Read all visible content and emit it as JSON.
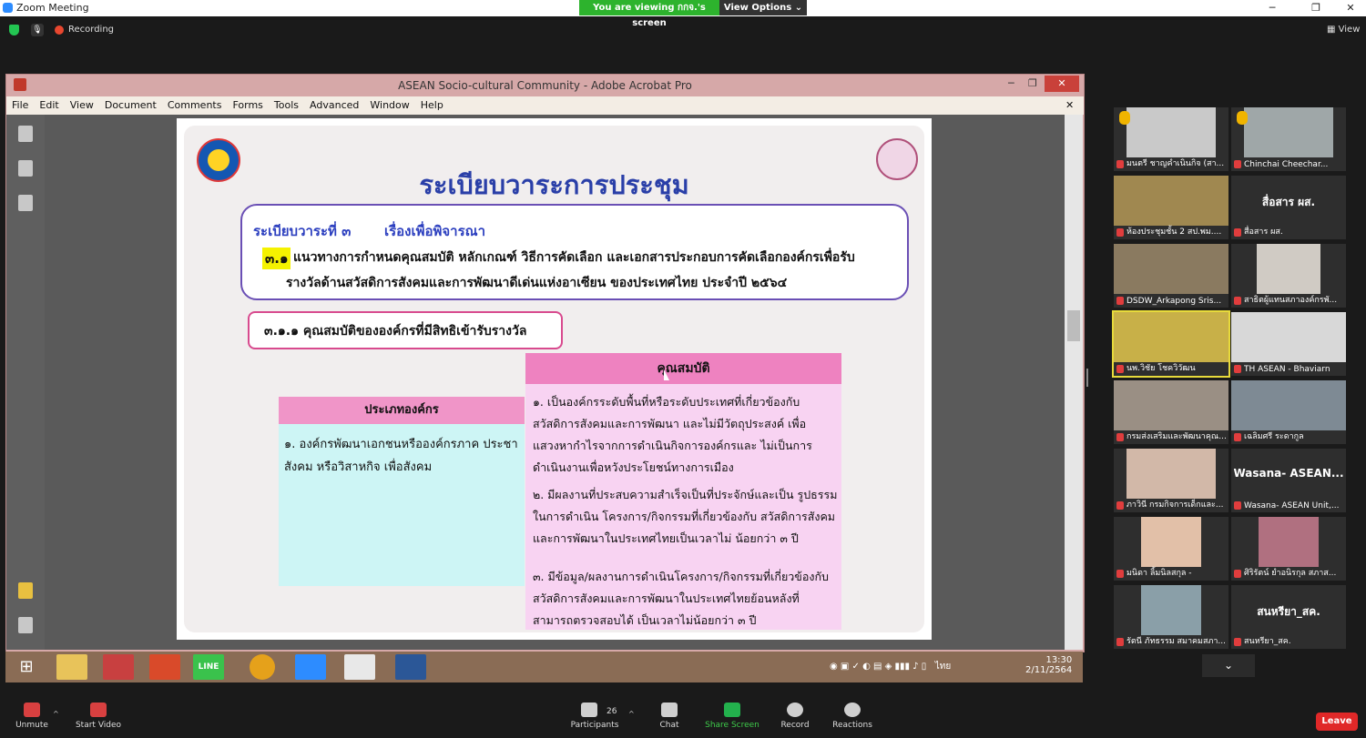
{
  "window": {
    "title": "Zoom Meeting",
    "viewing_banner": "You are viewing กกจ.'s screen",
    "view_options": "View Options ⌄",
    "min": "─",
    "max": "❐",
    "close": "✕"
  },
  "status": {
    "recording": "Recording",
    "view": "View"
  },
  "acrobat": {
    "title": "ASEAN Socio-cultural Community - Adobe Acrobat Pro",
    "menu": [
      "File",
      "Edit",
      "View",
      "Document",
      "Comments",
      "Forms",
      "Tools",
      "Advanced",
      "Window",
      "Help"
    ],
    "close_doc": "✕"
  },
  "slide": {
    "title": "ระเบียบวาระการประชุม",
    "agenda_heading": "ระเบียบวาระที่ ๓       เรื่องเพื่อพิจารณา",
    "item_num": "๓.๑",
    "item_line1": "แนวทางการกำหนดคุณสมบัติ หลักเกณฑ์ วิธีการคัดเลือก และเอกสารประกอบการคัดเลือกองค์กรเพื่อรับ",
    "item_line2": "รางวัลด้านสวัสดิการสังคมและการพัฒนาดีเด่นแห่งอาเซียน ของประเทศไทย ประจำปี ๒๕๖๔",
    "sub_item": "๓.๑.๑ คุณสมบัติขององค์กรที่มีสิทธิเข้ารับรางวัล",
    "left_header": "ประเภทองค์กร",
    "left_text": "๑.   องค์กรพัฒนาเอกชนหรือองค์กรภาค ประชาสังคม หรือวิสาหกิจ เพื่อสังคม",
    "right_header": "คุณสมบัติ",
    "right_items": [
      "๑.   เป็นองค์กรระดับพื้นที่หรือระดับประเทศที่เกี่ยวข้องกับ สวัสดิการสังคมและการพัฒนา และไม่มีวัตถุประสงค์ เพื่อแสวงหากำไรจากการดำเนินกิจการองค์กรและ ไม่เป็นการดำเนินงานเพื่อหวังประโยชน์ทางการเมือง",
      "๒.   มีผลงานที่ประสบความสำเร็จเป็นที่ประจักษ์และเป็น รูปธรรมในการดำเนิน โครงการ/กิจกรรมที่เกี่ยวข้องกับ สวัสดิการสังคมและการพัฒนาในประเทศไทยเป็นเวลาไม่ น้อยกว่า ๓ ปี",
      "๓.   มีข้อมูล/ผลงานการดำเนินโครงการ/กิจกรรมที่เกี่ยวข้องกับ สวัสดิการสังคมและการพัฒนาในประเทศไทยย้อนหลังที่ สามารถตรวจสอบได้ เป็นเวลาไม่น้อยกว่า ๓ ปี"
    ]
  },
  "taskbar": {
    "tray": "ไทย",
    "time": "13:30",
    "date": "2/11/2564"
  },
  "participants": [
    {
      "name": "มนตรี ชาญคำเนินกิจ (สา...",
      "big": ""
    },
    {
      "name": "Chinchai Cheechar...",
      "big": ""
    },
    {
      "name": "ห้องประชุมชั้น 2 สป.พม....",
      "big": ""
    },
    {
      "name": "สื่อสาร ผส.",
      "big": "สื่อสาร ผส."
    },
    {
      "name": "DSDW_Arkapong Sris...",
      "big": ""
    },
    {
      "name": "สาธิตผู้แทนสภาองค์กรพั...",
      "big": ""
    },
    {
      "name": "นพ.วิชัย โชควิวัฒน",
      "big": ""
    },
    {
      "name": "TH ASEAN - Bhaviarn",
      "big": ""
    },
    {
      "name": "กรมส่งเสริมและพัฒนาคุณ...",
      "big": ""
    },
    {
      "name": "เฉลิมศรี ระดากูล",
      "big": ""
    },
    {
      "name": "ภาวินี กรมกิจการเด็กและ...",
      "big": ""
    },
    {
      "name": "Wasana- ASEAN Unit,...",
      "big": "Wasana- ASEAN..."
    },
    {
      "name": "มนิดา ลิ้มนิลสกุล -",
      "big": ""
    },
    {
      "name": "ศิริรัตน์ ยำอนิรกุล สภาส...",
      "big": ""
    },
    {
      "name": "รัตนี ภัทธรรม สมาคมสภา...",
      "big": ""
    },
    {
      "name": "สนหรียา_สค.",
      "big": "สนหรียา_สค."
    }
  ],
  "toolbar": {
    "unmute": "Unmute",
    "start_video": "Start Video",
    "participants": "Participants",
    "participants_count": "26",
    "chat": "Chat",
    "share": "Share Screen",
    "record": "Record",
    "reactions": "Reactions",
    "leave": "Leave"
  },
  "colors": {
    "zoom_green": "#2db32d",
    "leave_red": "#e02828",
    "slide_title": "#2a3fa8",
    "highlight": "#f5f200",
    "pink_header": "#ee82c0",
    "cyan_panel": "#cdf5f5"
  }
}
